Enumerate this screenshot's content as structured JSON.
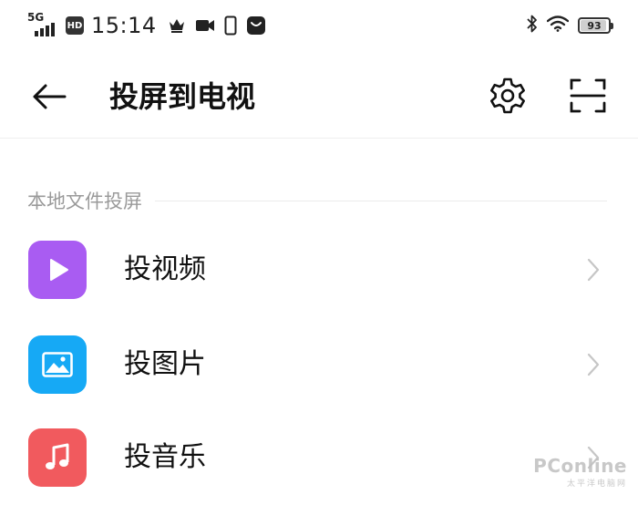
{
  "status_bar": {
    "network": "5G",
    "hd_badge": "HD",
    "time": "15:14",
    "battery": 93
  },
  "header": {
    "title": "投屏到电视"
  },
  "section": {
    "title": "本地文件投屏"
  },
  "items": [
    {
      "label": "投视频",
      "icon": "play-icon",
      "color": "#a95cf2"
    },
    {
      "label": "投图片",
      "icon": "image-icon",
      "color": "#16a9f5"
    },
    {
      "label": "投音乐",
      "icon": "music-note-icon",
      "color": "#f15a5e"
    }
  ],
  "watermark": {
    "main": "PConline",
    "sub": "太平洋电脑网"
  },
  "colors": {
    "section_text": "#9a9a9a",
    "chevron": "#c6c6c6"
  }
}
